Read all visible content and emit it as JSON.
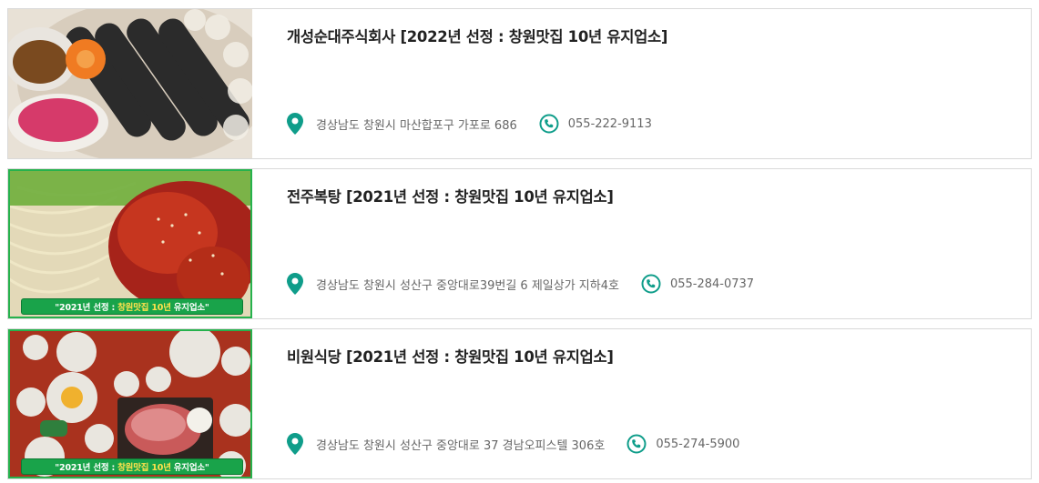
{
  "restaurants": [
    {
      "name": "개성순대주식회사 [2022년 선정 : 창원맛집 10년 유지업소]",
      "address": "경상남도 창원시 마산합포구 가포로 686",
      "phone": "055-222-9113"
    },
    {
      "name": "전주복탕 [2021년 선정 : 창원맛집 10년 유지업소]",
      "address": "경상남도 창원시 성산구 중앙대로39번길 6 제일상가 지하4호",
      "phone": "055-284-0737",
      "badge": {
        "prefix": "\"2021년 선정 :",
        "highlight": "창원맛집 10년",
        "suffix": "유지업소\""
      }
    },
    {
      "name": "비원식당 [2021년 선정 : 창원맛집 10년 유지업소]",
      "address": "경상남도 창원시 성산구 중앙대로 37 경남오피스텔 306호",
      "phone": "055-274-5900",
      "badge": {
        "prefix": "\"2021년 선정 :",
        "highlight": "창원맛집 10년",
        "suffix": "유지업소\""
      }
    }
  ],
  "colors": {
    "icon_teal": "#0f9d8a",
    "badge_green": "#19a34a"
  },
  "icons": {
    "location": "map-pin-icon",
    "phone": "phone-icon"
  }
}
